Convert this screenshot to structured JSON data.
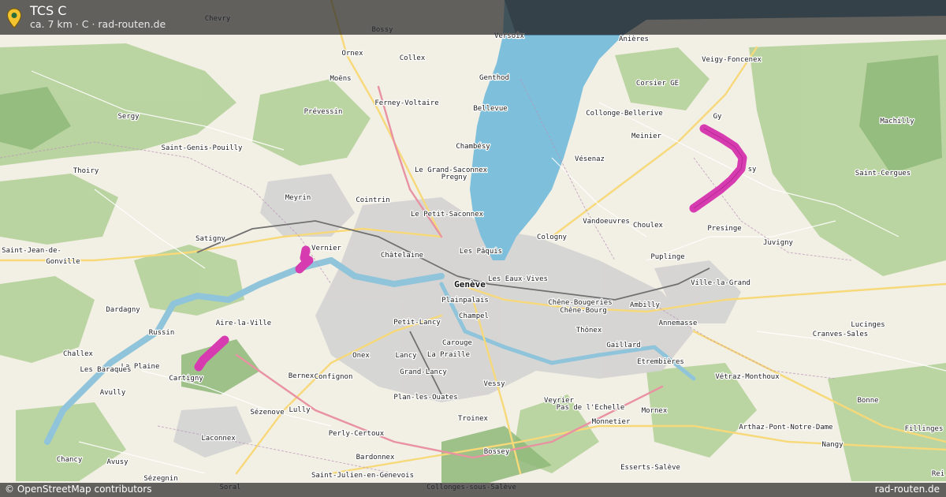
{
  "header": {
    "title": "TCS C",
    "subtitle": "ca. 7 km · C · rad-routen.de",
    "icon": "location-pin-icon"
  },
  "footer": {
    "attribution": "© OpenStreetMap contributors",
    "brand": "rad-routen.de"
  },
  "colors": {
    "route": "#d63cb0",
    "lake": "#7ec0dc",
    "land": "#f2efe4",
    "forest": "#a6c98a",
    "urban": "#d4d4d4"
  },
  "map": {
    "places": [
      {
        "id": "chevry",
        "label": "Chevry"
      },
      {
        "id": "bossy1",
        "label": "Bossy"
      },
      {
        "id": "versoix",
        "label": "Versoix"
      },
      {
        "id": "anieres",
        "label": "Anières"
      },
      {
        "id": "ornex",
        "label": "Ornex"
      },
      {
        "id": "collex",
        "label": "Collex"
      },
      {
        "id": "veigy",
        "label": "Veigy-Foncenex"
      },
      {
        "id": "moens",
        "label": "Moëns"
      },
      {
        "id": "genthod",
        "label": "Genthod"
      },
      {
        "id": "corsier",
        "label": "Corsier GE"
      },
      {
        "id": "ferney",
        "label": "Ferney-Voltaire"
      },
      {
        "id": "prevessin",
        "label": "Prévessin"
      },
      {
        "id": "bellevue",
        "label": "Bellevue"
      },
      {
        "id": "collonge",
        "label": "Collonge-Bellerive"
      },
      {
        "id": "gy",
        "label": "Gy"
      },
      {
        "id": "sergy",
        "label": "Sergy"
      },
      {
        "id": "machilly",
        "label": "Machilly"
      },
      {
        "id": "meinier",
        "label": "Meinier"
      },
      {
        "id": "chambesy",
        "label": "Chambésy"
      },
      {
        "id": "sgp",
        "label": "Saint-Genis-Pouilly"
      },
      {
        "id": "vesenaz",
        "label": "Vésenaz"
      },
      {
        "id": "jussy",
        "label": "sy"
      },
      {
        "id": "thoiry",
        "label": "Thoiry"
      },
      {
        "id": "saconnex",
        "label": "Le Grand-Saconnex"
      },
      {
        "id": "pregny",
        "label": "Pregny"
      },
      {
        "id": "stcergues",
        "label": "Saint-Cergues"
      },
      {
        "id": "meyrin",
        "label": "Meyrin"
      },
      {
        "id": "cointrin",
        "label": "Cointrin"
      },
      {
        "id": "petitsaconnex",
        "label": "Le Petit-Saconnex"
      },
      {
        "id": "vandoeuvres",
        "label": "Vandoeuvres"
      },
      {
        "id": "choulex",
        "label": "Choulex"
      },
      {
        "id": "presinge",
        "label": "Presinge"
      },
      {
        "id": "satigny",
        "label": "Satigny"
      },
      {
        "id": "cologny",
        "label": "Cologny"
      },
      {
        "id": "juvigny",
        "label": "Juvigny"
      },
      {
        "id": "stjean",
        "label": "Saint-Jean-de-"
      },
      {
        "id": "vernier",
        "label": "Vernier"
      },
      {
        "id": "lespaquis",
        "label": "Les Pâquis"
      },
      {
        "id": "gonville",
        "label": "Gonville"
      },
      {
        "id": "chatelaine",
        "label": "Châtelaine"
      },
      {
        "id": "puplinge",
        "label": "Puplinge"
      },
      {
        "id": "geneve",
        "label": "Genève"
      },
      {
        "id": "eauxvives",
        "label": "Les Eaux-Vives"
      },
      {
        "id": "villelagrand",
        "label": "Ville-la-Grand"
      },
      {
        "id": "plainpalais",
        "label": "Plainpalais"
      },
      {
        "id": "chenebougeries",
        "label": "Chêne-Bougeries"
      },
      {
        "id": "ambilly",
        "label": "Ambilly"
      },
      {
        "id": "dardagny",
        "label": "Dardagny"
      },
      {
        "id": "chenebourg",
        "label": "Chêne-Bourg"
      },
      {
        "id": "annemasse",
        "label": "Annemasse"
      },
      {
        "id": "chapel",
        "label": "Champel"
      },
      {
        "id": "airelaville",
        "label": "Aire-la-Ville"
      },
      {
        "id": "petitlancy",
        "label": "Petit-Lancy"
      },
      {
        "id": "lucinges",
        "label": "Lucinges"
      },
      {
        "id": "thonex",
        "label": "Thônex"
      },
      {
        "id": "russin",
        "label": "Russin"
      },
      {
        "id": "carouge",
        "label": "Carouge"
      },
      {
        "id": "gaillard",
        "label": "Gaillard"
      },
      {
        "id": "cranves",
        "label": "Cranves-Sales"
      },
      {
        "id": "challex",
        "label": "Challex"
      },
      {
        "id": "onex",
        "label": "Onex"
      },
      {
        "id": "lancy",
        "label": "Lancy"
      },
      {
        "id": "lapraille",
        "label": "La Praille"
      },
      {
        "id": "laplaine",
        "label": "La Plaine"
      },
      {
        "id": "etrembieres",
        "label": "Etrembières"
      },
      {
        "id": "lesbaraques",
        "label": "Les Baraques"
      },
      {
        "id": "grandlancy",
        "label": "Grand-Lancy"
      },
      {
        "id": "bernex",
        "label": "Bernex"
      },
      {
        "id": "cartigny",
        "label": "Cartigny"
      },
      {
        "id": "confignon",
        "label": "Confignon"
      },
      {
        "id": "vetraz",
        "label": "Vétraz-Monthoux"
      },
      {
        "id": "vessy",
        "label": "Vessy"
      },
      {
        "id": "avully",
        "label": "Avully"
      },
      {
        "id": "planlesouates",
        "label": "Plan-les-Ouates"
      },
      {
        "id": "bonne",
        "label": "Bonne"
      },
      {
        "id": "veyrier",
        "label": "Veyrier"
      },
      {
        "id": "pasdelechelle",
        "label": "Pas de l'Echelle"
      },
      {
        "id": "mornex",
        "label": "Mornex"
      },
      {
        "id": "sezenove",
        "label": "Sézenove"
      },
      {
        "id": "lully",
        "label": "Lully"
      },
      {
        "id": "troinex",
        "label": "Troinex"
      },
      {
        "id": "monnetier",
        "label": "Monnetier"
      },
      {
        "id": "arthaz",
        "label": "Arthaz-Pont-Notre-Dame"
      },
      {
        "id": "laconnex",
        "label": "Laconnex"
      },
      {
        "id": "perly",
        "label": "Perly-Certoux"
      },
      {
        "id": "fillinges",
        "label": "Fillinges"
      },
      {
        "id": "nangy",
        "label": "Nangy"
      },
      {
        "id": "chancy",
        "label": "Chancy"
      },
      {
        "id": "avusy",
        "label": "Avusy"
      },
      {
        "id": "bardonnex",
        "label": "Bardonnex"
      },
      {
        "id": "bossy2",
        "label": "Bossey"
      },
      {
        "id": "essert",
        "label": "Esserts-Salève"
      },
      {
        "id": "sezegnin",
        "label": "Sézegnin"
      },
      {
        "id": "soral",
        "label": "Soral"
      },
      {
        "id": "stjulien",
        "label": "Saint-Julien-en-Genevois"
      },
      {
        "id": "collonges",
        "label": "Collonges-sous-Salève"
      },
      {
        "id": "reignier",
        "label": "Rei"
      }
    ]
  }
}
